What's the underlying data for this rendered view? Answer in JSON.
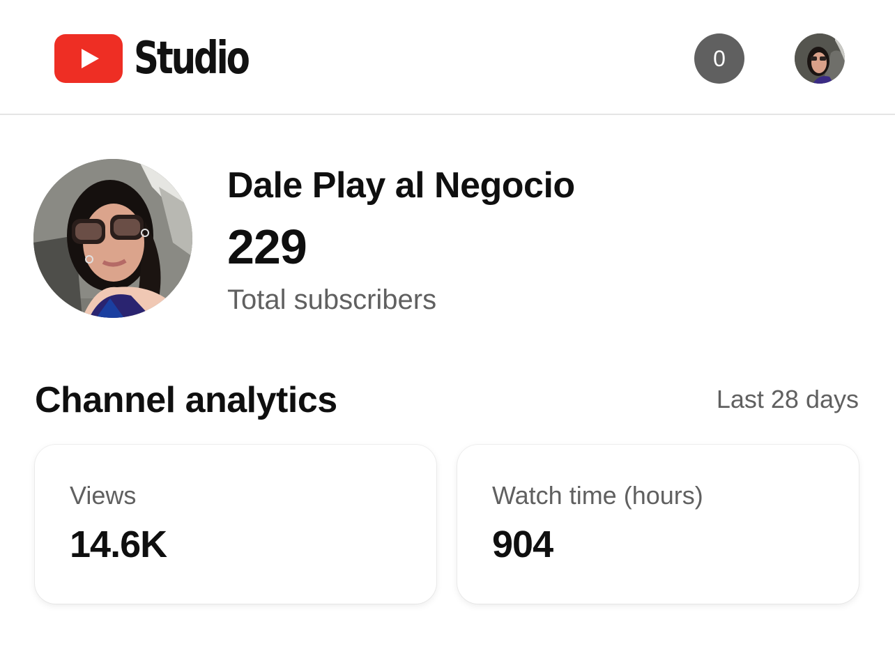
{
  "header": {
    "app_name": "Studio",
    "notification_count": "0",
    "avatar_icon": "profile-photo-icon"
  },
  "channel": {
    "name": "Dale Play al Negocio",
    "subscriber_count": "229",
    "subscriber_label": "Total subscribers"
  },
  "analytics": {
    "title": "Channel analytics",
    "period": "Last 28 days",
    "cards": [
      {
        "label": "Views",
        "value": "14.6K"
      },
      {
        "label": "Watch time (hours)",
        "value": "904"
      }
    ]
  },
  "colors": {
    "brand_red": "#ee2e24",
    "badge_gray": "#606060"
  }
}
